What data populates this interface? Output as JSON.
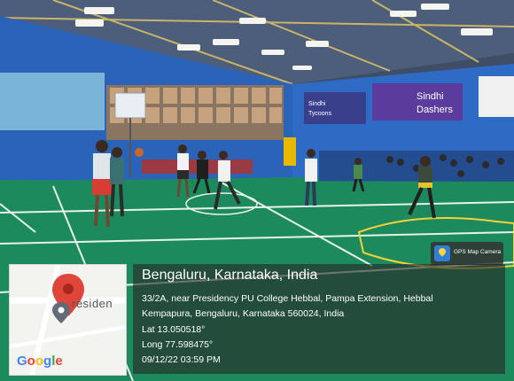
{
  "overlay": {
    "location_title": "Bengaluru, Karnataka, India",
    "address_line_1": "33/2A, near Presidency PU College Hebbal, Pampa Extension, Hebbal",
    "address_line_2": "Kempapura, Bengaluru, Karnataka 560024, India",
    "latitude": "Lat 13.050518°",
    "longitude": "Long 77.598475°",
    "timestamp": "09/12/22 03:59 PM",
    "app_badge": "GPS Map Camera",
    "map_street_label": "residen",
    "map_brand": [
      "G",
      "o",
      "o",
      "g",
      "l",
      "e"
    ]
  },
  "banners": {
    "left_banner_top": "Sindhi",
    "left_banner_bottom": "Tycoons",
    "right_banner_top": "Sindhi",
    "right_banner_bottom": "Dashers"
  },
  "colors": {
    "court_green": "#1d8a5e",
    "wall_blue": "#2a63b8",
    "banner_purple": "#5b3b9c",
    "overlay_bg": "#262626",
    "pin_red": "#e0453a"
  }
}
